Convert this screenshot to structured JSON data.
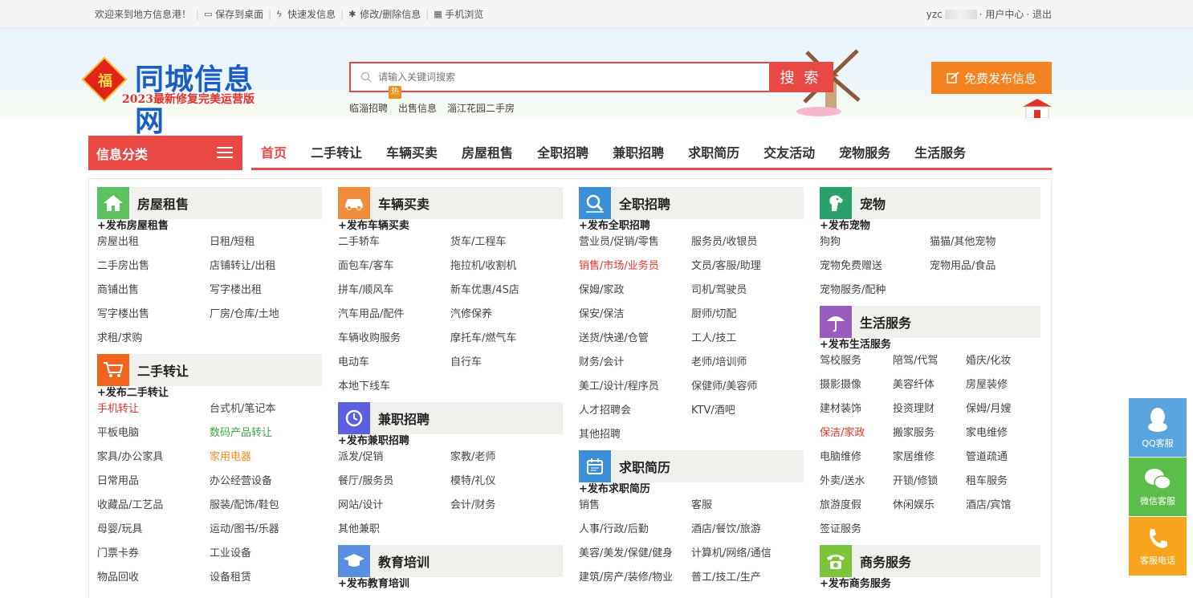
{
  "topbar": {
    "welcome": "欢迎来到地方信息港！",
    "save_desktop": "保存到桌面",
    "quick_post": "快速发信息",
    "edit_delete": "修改/删除信息",
    "mobile": "手机浏览",
    "user_prefix": "yzc",
    "user_center": "· 用户中心",
    "logout": "· 退出"
  },
  "logo": {
    "badge": "福",
    "title": "同城信息网",
    "subtitle": "2023最新修复完美运营版"
  },
  "search": {
    "placeholder": "请输入关键词搜索",
    "button": "搜 索",
    "hot_tag": "热",
    "hotwords": [
      "临淄招聘",
      "出售信息",
      "淄江花园二手房"
    ]
  },
  "publish_button": "免费发布信息",
  "nav": {
    "category_label": "信息分类",
    "links": [
      "首页",
      "二手转让",
      "车辆买卖",
      "房屋租售",
      "全职招聘",
      "兼职招聘",
      "求职简历",
      "交友活动",
      "宠物服务",
      "生活服务"
    ]
  },
  "sections": {
    "house": {
      "title": "房屋租售",
      "post": "+发布房屋租售",
      "items": [
        "房屋出租",
        "日租/短租",
        "二手房出售",
        "店铺转让/出租",
        "商铺出售",
        "写字楼出租",
        "写字楼出售",
        "厂房/仓库/土地",
        "求租/求购"
      ]
    },
    "secondhand": {
      "title": "二手转让",
      "post": "+发布二手转让",
      "items": [
        "手机转让",
        "台式机/笔记本",
        "平板电脑",
        "数码产品转让",
        "家具/办公家具",
        "家用电器",
        "日常用品",
        "办公经营设备",
        "收藏品/工艺品",
        "服装/配饰/鞋包",
        "母婴/玩具",
        "运动/图书/乐器",
        "门票卡券",
        "工业设备",
        "物品回收",
        "设备租赁"
      ]
    },
    "car": {
      "title": "车辆买卖",
      "post": "+发布车辆买卖",
      "items": [
        "二手轿车",
        "货车/工程车",
        "面包车/客车",
        "拖拉机/收割机",
        "拼车/顺风车",
        "新车优惠/4S店",
        "汽车用品/配件",
        "汽修保养",
        "车辆收购服务",
        "摩托车/燃气车",
        "电动车",
        "自行车",
        "本地下线车"
      ]
    },
    "parttime": {
      "title": "兼职招聘",
      "post": "+发布兼职招聘",
      "items": [
        "派发/促销",
        "家教/老师",
        "餐厅/服务员",
        "模特/礼仪",
        "网站/设计",
        "会计/财务",
        "其他兼职"
      ]
    },
    "edu": {
      "title": "教育培训",
      "post": "+发布教育培训"
    },
    "fulltime": {
      "title": "全职招聘",
      "post": "+发布全职招聘",
      "items": [
        "营业员/促销/零售",
        "服务员/收银员",
        "销售/市场/业务员",
        "文员/客服/助理",
        "保姆/家政",
        "司机/驾驶员",
        "保安/保洁",
        "厨师/切配",
        "送货/快递/仓管",
        "工人/技工",
        "财务/会计",
        "老师/培训师",
        "美工/设计/程序员",
        "保健师/美容师",
        "人才招聘会",
        "KTV/酒吧",
        "其他招聘"
      ]
    },
    "resume": {
      "title": "求职简历",
      "post": "+发布求职简历",
      "items": [
        "销售",
        "客服",
        "人事/行政/后勤",
        "酒店/餐饮/旅游",
        "美容/美发/保健/健身",
        "计算机/网络/通信",
        "建筑/房产/装修/物业",
        "普工/技工/生产"
      ]
    },
    "pet": {
      "title": "宠物",
      "post": "+发布宠物",
      "items": [
        "狗狗",
        "猫猫/其他宠物",
        "宠物免费赠送",
        "宠物用品/食品",
        "宠物服务/配种"
      ]
    },
    "life": {
      "title": "生活服务",
      "post": "+发布生活服务",
      "items": [
        "驾校服务",
        "陪驾/代驾",
        "婚庆/化妆",
        "摄影摄像",
        "美容纤体",
        "房屋装修",
        "建材装饰",
        "投资理财",
        "保姆/月嫂",
        "保洁/家政",
        "搬家服务",
        "家电维修",
        "电脑维修",
        "家居维修",
        "管道疏通",
        "外卖/送水",
        "开锁/修锁",
        "租车服务",
        "旅游度假",
        "休闲娱乐",
        "酒店/宾馆",
        "签证服务"
      ]
    },
    "biz": {
      "title": "商务服务",
      "post": "+发布商务服务"
    }
  },
  "float": {
    "qq": "QQ客服",
    "wechat": "微信客服",
    "phone": "客服电话"
  },
  "colors": {
    "accent_red": "#e94844",
    "publish_orange": "#f58220",
    "logo_blue": "#1c5fc4"
  }
}
